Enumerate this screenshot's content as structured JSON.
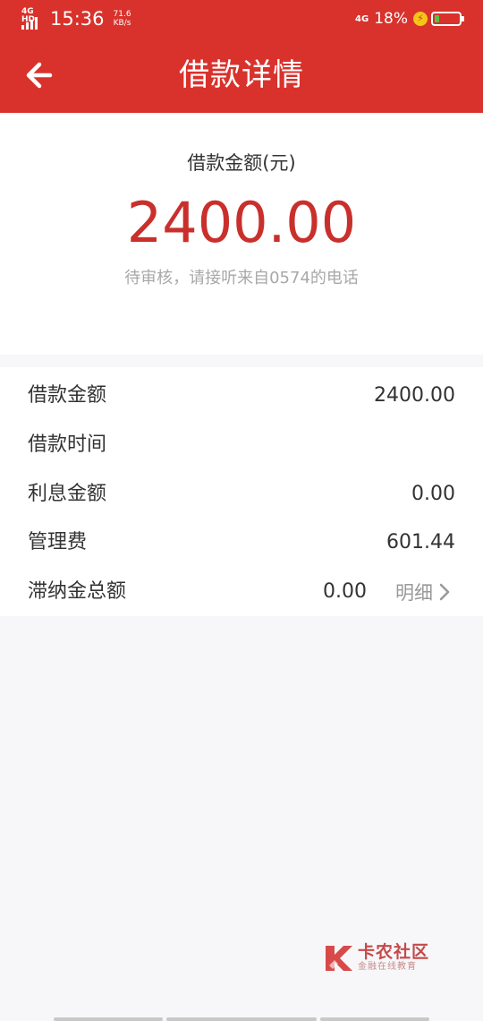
{
  "status_bar": {
    "network_left": "4G HD",
    "time": "15:36",
    "speed_value": "71.6",
    "speed_unit": "KB/s",
    "network_right": "4G",
    "battery_percent": "18%",
    "battery_level": 0.18,
    "battery_color": "#52c43f"
  },
  "header": {
    "back_icon": "arrow-left-icon",
    "title": "借款详情"
  },
  "summary": {
    "label": "借款金额(元)",
    "amount": "2400.00",
    "status_text": "待审核，请接听来自0574的电话"
  },
  "details": {
    "rows": [
      {
        "label": "借款金额",
        "value": "2400.00"
      },
      {
        "label": "借款时间",
        "value": ""
      },
      {
        "label": "利息金额",
        "value": "0.00"
      },
      {
        "label": "管理费",
        "value": "601.44"
      },
      {
        "label": "滞纳金总额",
        "value": "0.00",
        "link": "明细"
      }
    ]
  },
  "watermark": {
    "name": "卡农社区",
    "tagline": "金融在线教育"
  },
  "colors": {
    "primary": "#d9322c",
    "amount": "#c9302c"
  }
}
